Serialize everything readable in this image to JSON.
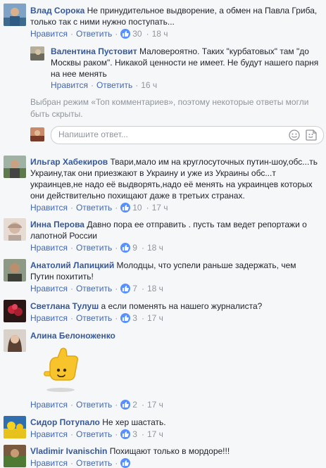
{
  "actions": {
    "like": "Нравится",
    "reply": "Ответить"
  },
  "comments": [
    {
      "author": "Влад Сорока",
      "text": "Не принудительное выдворение, а обмен на Павла Гриба, только так с ними нужно поступать...",
      "likes": "30",
      "time": "18 ч"
    },
    {
      "author": "Валентина Пустовит",
      "text": "Маловероятно. Таких \"курбатовых\" там \"до Москвы раком\". Никакой ценности не имеет. Не будут нашего парня на нее менять",
      "likes": "",
      "time": "16 ч"
    },
    {
      "author": "Ильгар Хабекиров",
      "text": "Твари,мало им на круглосуточных путин-шоу,обс...ть Украину,так они приезжают в Украину и уже из Украины обс...т украинцев,не надо её выдворять,надо её менять на украинцев которых они действительно похищают даже в третьих странах.",
      "likes": "10",
      "time": "17 ч"
    },
    {
      "author": "Инна Перова",
      "text": "Давно пора ее отправить . пусть там ведет репортажи о лапотной России",
      "likes": "9",
      "time": "18 ч"
    },
    {
      "author": "Анатолий Лапицкий",
      "text": "Молодцы, что успели раньше задержать, чем Путин похитить!",
      "likes": "7",
      "time": "18 ч"
    },
    {
      "author": "Светлана Тулуш",
      "text": "а если поменять на нашего журналиста?",
      "likes": "3",
      "time": "17 ч"
    },
    {
      "author": "Алина Белоноженко",
      "text": "",
      "likes": "2",
      "time": "17 ч"
    },
    {
      "author": "Сидор Потупало",
      "text": "Не хер шастать.",
      "likes": "3",
      "time": "17 ч"
    },
    {
      "author": "Vladimir Ivanischin",
      "text": "Похищают только в мордоре!!!",
      "likes": "",
      "time": ""
    }
  ],
  "notice": "Выбран режим «Топ комментариев», поэтому некоторые ответы могли быть скрыты.",
  "reply_placeholder": "Напишите ответ...",
  "colors": {
    "author": "#365899",
    "link": "#4267b2",
    "meta": "#90949c",
    "like": "#5890ff",
    "bg": "#f6f7f9"
  }
}
